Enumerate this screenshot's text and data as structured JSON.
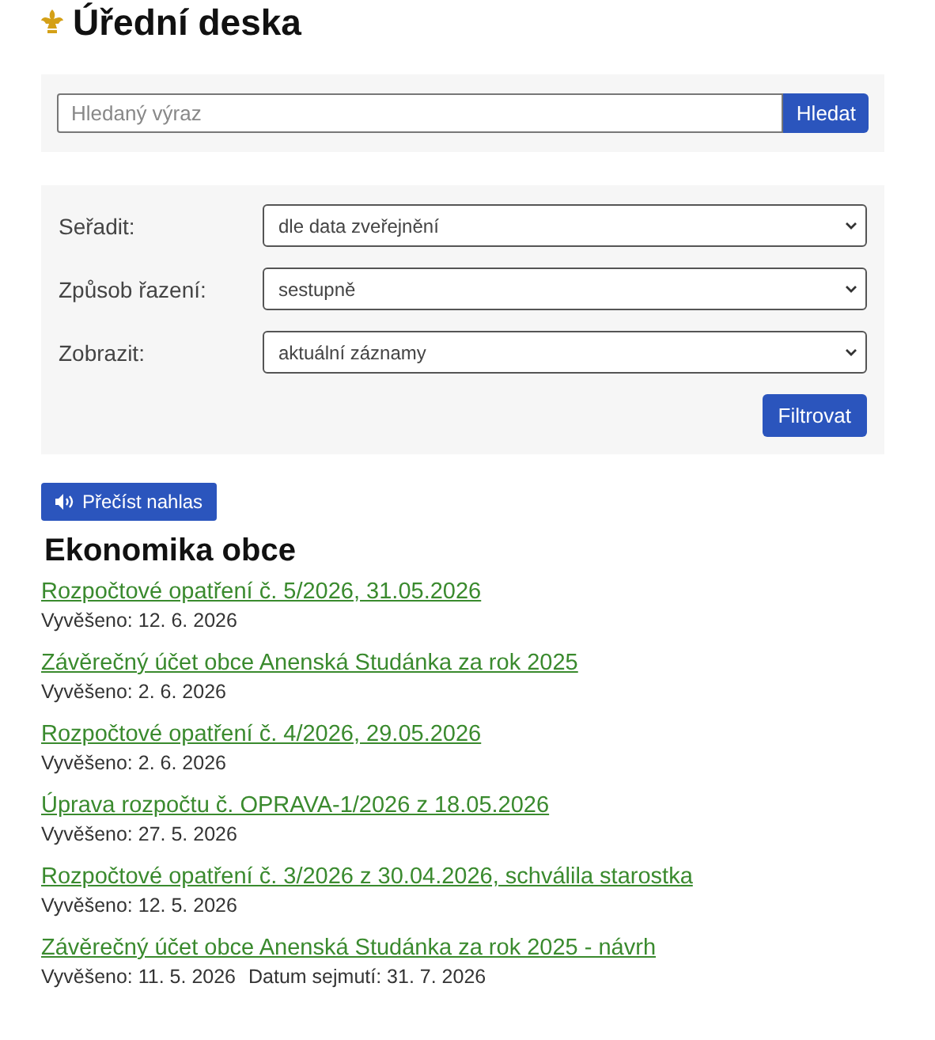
{
  "page_title": "Úřední deska",
  "search": {
    "placeholder": "Hledaný výraz",
    "button": "Hledat"
  },
  "filters": [
    {
      "label": "Seřadit:",
      "value": "dle data zveřejnění"
    },
    {
      "label": "Způsob řazení:",
      "value": "sestupně"
    },
    {
      "label": "Zobrazit:",
      "value": "aktuální záznamy"
    }
  ],
  "filter_button": "Filtrovat",
  "read_aloud_button": "Přečíst nahlas",
  "section_title": "Ekonomika obce",
  "items": [
    {
      "title": "Rozpočtové opatření č. 5/2026, 31.05.2026",
      "posted": "Vyvěšeno: 12. 6. 2026"
    },
    {
      "title": "Závěrečný účet obce Anenská Studánka za rok 2025",
      "posted": "Vyvěšeno: 2. 6. 2026"
    },
    {
      "title": "Rozpočtové opatření č. 4/2026, 29.05.2026",
      "posted": "Vyvěšeno: 2. 6. 2026"
    },
    {
      "title": "Úprava rozpočtu č. OPRAVA-1/2026 z 18.05.2026",
      "posted": "Vyvěšeno: 27. 5. 2026"
    },
    {
      "title": "Rozpočtové opatření č. 3/2026 z 30.04.2026, schválila starostka",
      "posted": "Vyvěšeno: 12. 5. 2026"
    },
    {
      "title": "Závěrečný účet obce Anenská Studánka za rok 2025 - návrh",
      "posted": "Vyvěšeno: 11. 5. 2026",
      "removal": "Datum sejmutí: 31. 7. 2026"
    }
  ]
}
